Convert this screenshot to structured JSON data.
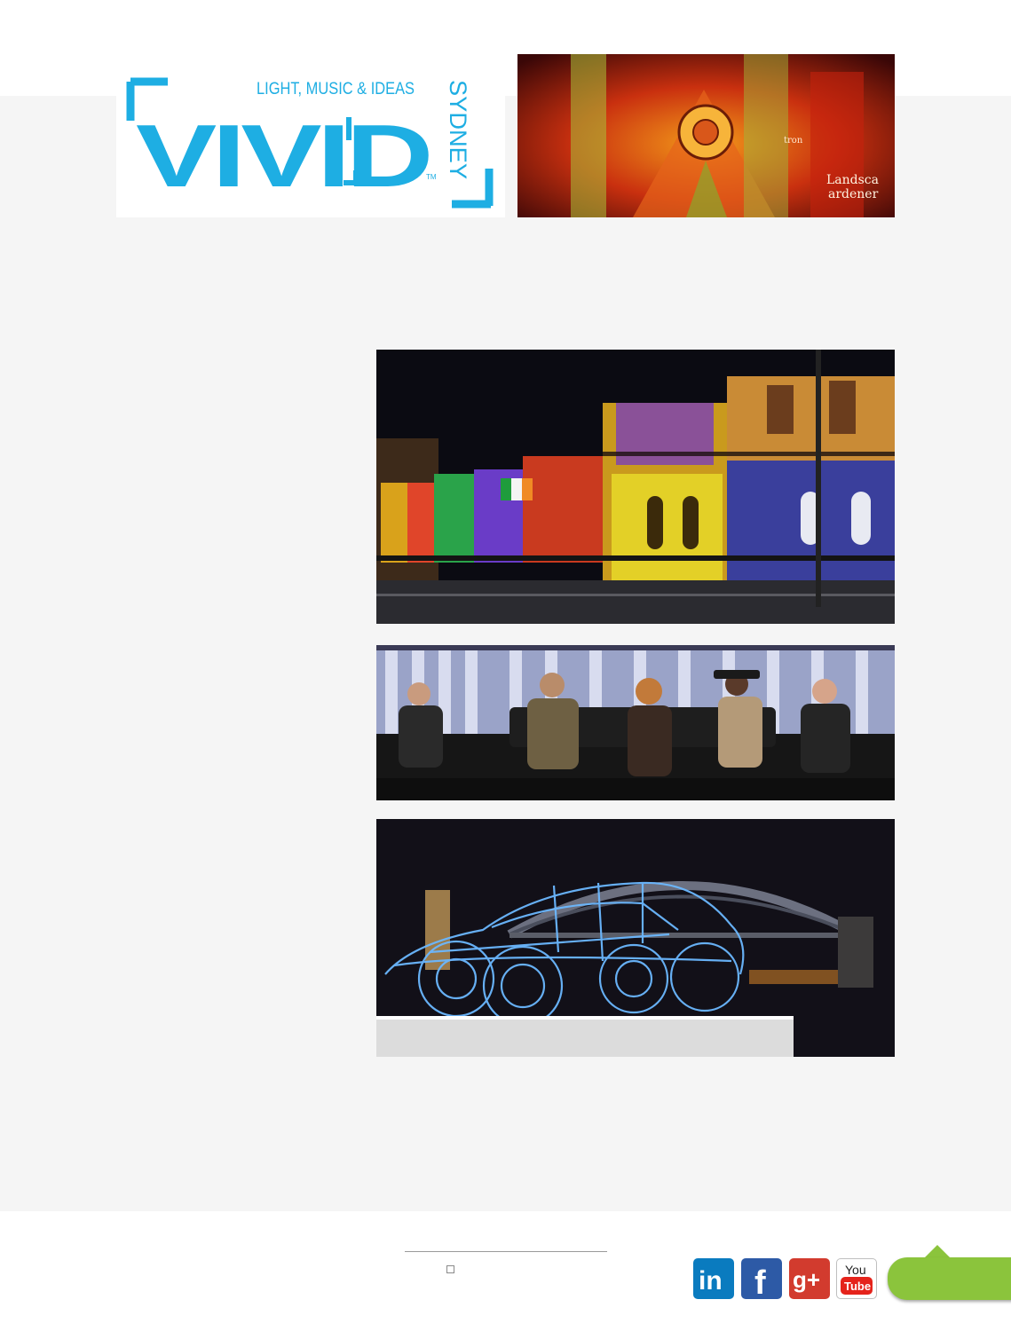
{
  "logo": {
    "wordmark": "VIVID",
    "tagline": "LIGHT, MUSIC & IDEAS",
    "city": "SYDNEY",
    "trademark": "TM",
    "brand_color": "#1eaee3"
  },
  "photos": {
    "cathedral": {
      "signage_line1": "tron",
      "signage_line2": "Landsca",
      "signage_line3": "ardener"
    }
  },
  "social": {
    "linkedin_text": "in",
    "facebook_text": "f",
    "gplus_text": "g+",
    "youtube_text_1": "You",
    "youtube_text_2": "Tube"
  },
  "colors": {
    "panel": "#f5f5f5",
    "accent_green": "#8bc43c",
    "linkedin": "#0a7bbf",
    "facebook": "#2d5aa6",
    "gplus": "#d23b2e",
    "youtube_red": "#e5231b"
  }
}
